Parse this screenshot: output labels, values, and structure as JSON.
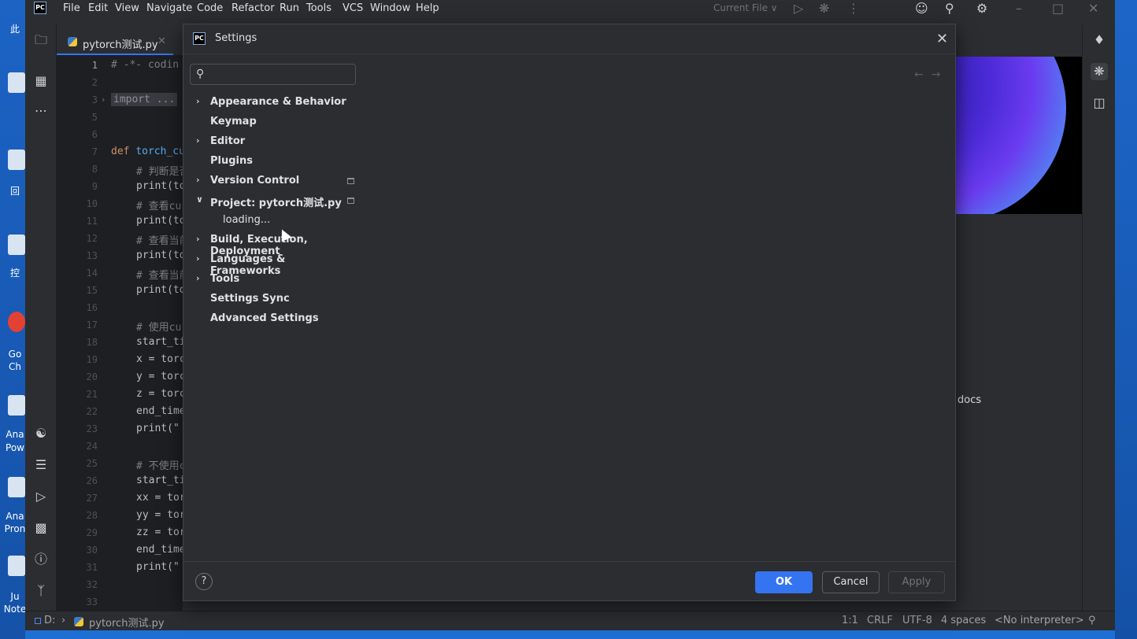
{
  "desktop": {
    "labels": [
      "此",
      "回",
      "控",
      "Go",
      "Ch",
      "Ana",
      "Pow",
      "Ana",
      "Pron",
      "Ju",
      "Note"
    ]
  },
  "menubar": {
    "items": [
      "File",
      "Edit",
      "View",
      "Navigate",
      "Code",
      "Refactor",
      "Run",
      "Tools",
      "VCS",
      "Window",
      "Help"
    ],
    "run_config": "Current File ∨"
  },
  "editor": {
    "tab_name": "pytorch测试.py",
    "line_numbers": [
      "1",
      "2",
      "3",
      "5",
      "6",
      "7",
      "8",
      "9",
      "10",
      "11",
      "12",
      "13",
      "14",
      "15",
      "16",
      "17",
      "18",
      "19",
      "20",
      "21",
      "22",
      "23",
      "24",
      "25",
      "26",
      "27",
      "28",
      "29",
      "30",
      "31",
      "32",
      "33"
    ],
    "lines": {
      "l1": "# -*- codin",
      "l3": "import ...",
      "l7_kw": "def ",
      "l7_fn": "torch_cu",
      "l8": "# 判断是否",
      "l9": "print(to",
      "l10": "# 查看cu",
      "l11": "print(to",
      "l12": "# 查看当前",
      "l13": "print(to",
      "l14": "# 查看当前",
      "l15": "print(to",
      "l17": "# 使用cu",
      "l18": "start_ti",
      "l19": "x = torc",
      "l20": "y = torc",
      "l21": "z = torc",
      "l22": "end_time",
      "l23": "print(\"",
      "l25": "# 不使用c",
      "l26": "start_ti",
      "l27": "xx = tor",
      "l28": "yy = tor",
      "l29": "zz = tor",
      "l30": "end_time",
      "l31": "print(\""
    }
  },
  "right_panel": {
    "docs_label": "docs"
  },
  "dialog": {
    "title": "Settings",
    "search_placeholder": "",
    "tree": [
      {
        "label": "Appearance & Behavior",
        "chevron": "›"
      },
      {
        "label": "Keymap",
        "chevron": ""
      },
      {
        "label": "Editor",
        "chevron": "›"
      },
      {
        "label": "Plugins",
        "chevron": ""
      },
      {
        "label": "Version Control",
        "chevron": "›"
      },
      {
        "label": "Project: pytorch测试.py",
        "chevron": "∨"
      },
      {
        "label": "loading...",
        "chevron": ""
      },
      {
        "label": "Build, Execution, Deployment",
        "chevron": "›"
      },
      {
        "label": "Languages & Frameworks",
        "chevron": "›"
      },
      {
        "label": "Tools",
        "chevron": "›"
      },
      {
        "label": "Settings Sync",
        "chevron": ""
      },
      {
        "label": "Advanced Settings",
        "chevron": ""
      }
    ],
    "help_label": "?",
    "ok_label": "OK",
    "cancel_label": "Cancel",
    "apply_label": "Apply"
  },
  "statusbar": {
    "path_drive": "D:",
    "path_file": "pytorch测试.py",
    "position": "1:1",
    "line_sep": "CRLF",
    "encoding": "UTF-8",
    "indent": "4 spaces",
    "interpreter": "<No interpreter>"
  }
}
